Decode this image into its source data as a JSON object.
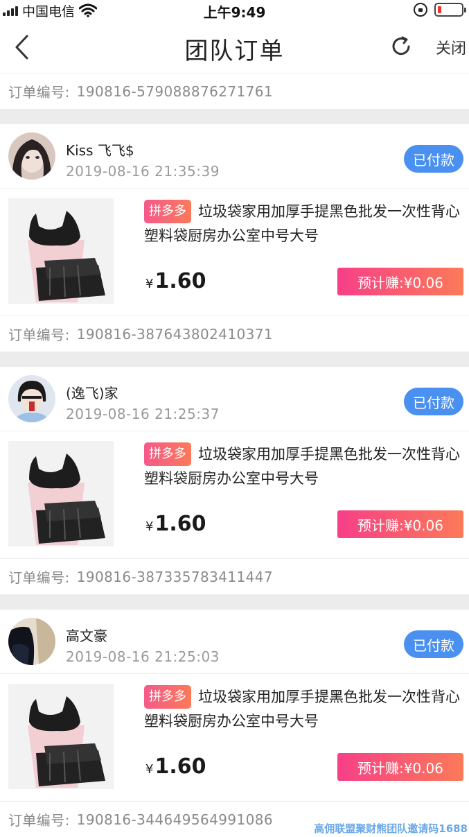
{
  "status_bar": {
    "carrier": "中国电信",
    "time": "上午9:49"
  },
  "nav": {
    "title": "团队订单",
    "close_label": "关闭"
  },
  "top_order_no": {
    "label": "订单编号:",
    "value": "190816-579088876271761"
  },
  "paid_label": "已付款",
  "pdd_tag": "拼多多",
  "currency_symbol": "¥",
  "orders": [
    {
      "user_name": "Kiss 飞飞$",
      "datetime": "2019-08-16 21:35:39",
      "status": "已付款",
      "product_title": "垃圾袋家用加厚手提黑色批发一次性背心塑料袋厨房办公室中号大号",
      "price": "1.60",
      "earn": "预计赚:¥0.06",
      "order_no_label": "订单编号:",
      "order_no": "190816-387643802410371"
    },
    {
      "user_name": "(逸飞)家",
      "datetime": "2019-08-16 21:25:37",
      "status": "已付款",
      "product_title": "垃圾袋家用加厚手提黑色批发一次性背心塑料袋厨房办公室中号大号",
      "price": "1.60",
      "earn": "预计赚:¥0.06",
      "order_no_label": "订单编号:",
      "order_no": "190816-387335783411447"
    },
    {
      "user_name": "高文豪",
      "datetime": "2019-08-16 21:25:03",
      "status": "已付款",
      "product_title": "垃圾袋家用加厚手提黑色批发一次性背心塑料袋厨房办公室中号大号",
      "price": "1.60",
      "earn": "预计赚:¥0.06",
      "order_no_label": "订单编号:",
      "order_no": "190816-344649564991086"
    }
  ],
  "watermark": "高佣联盟聚财熊团队邀请码1688",
  "colors": {
    "paid_badge": "#4a90f0",
    "earn_gradient_start": "#f73f88",
    "earn_gradient_end": "#fb7a58",
    "separator": "#ececec"
  }
}
